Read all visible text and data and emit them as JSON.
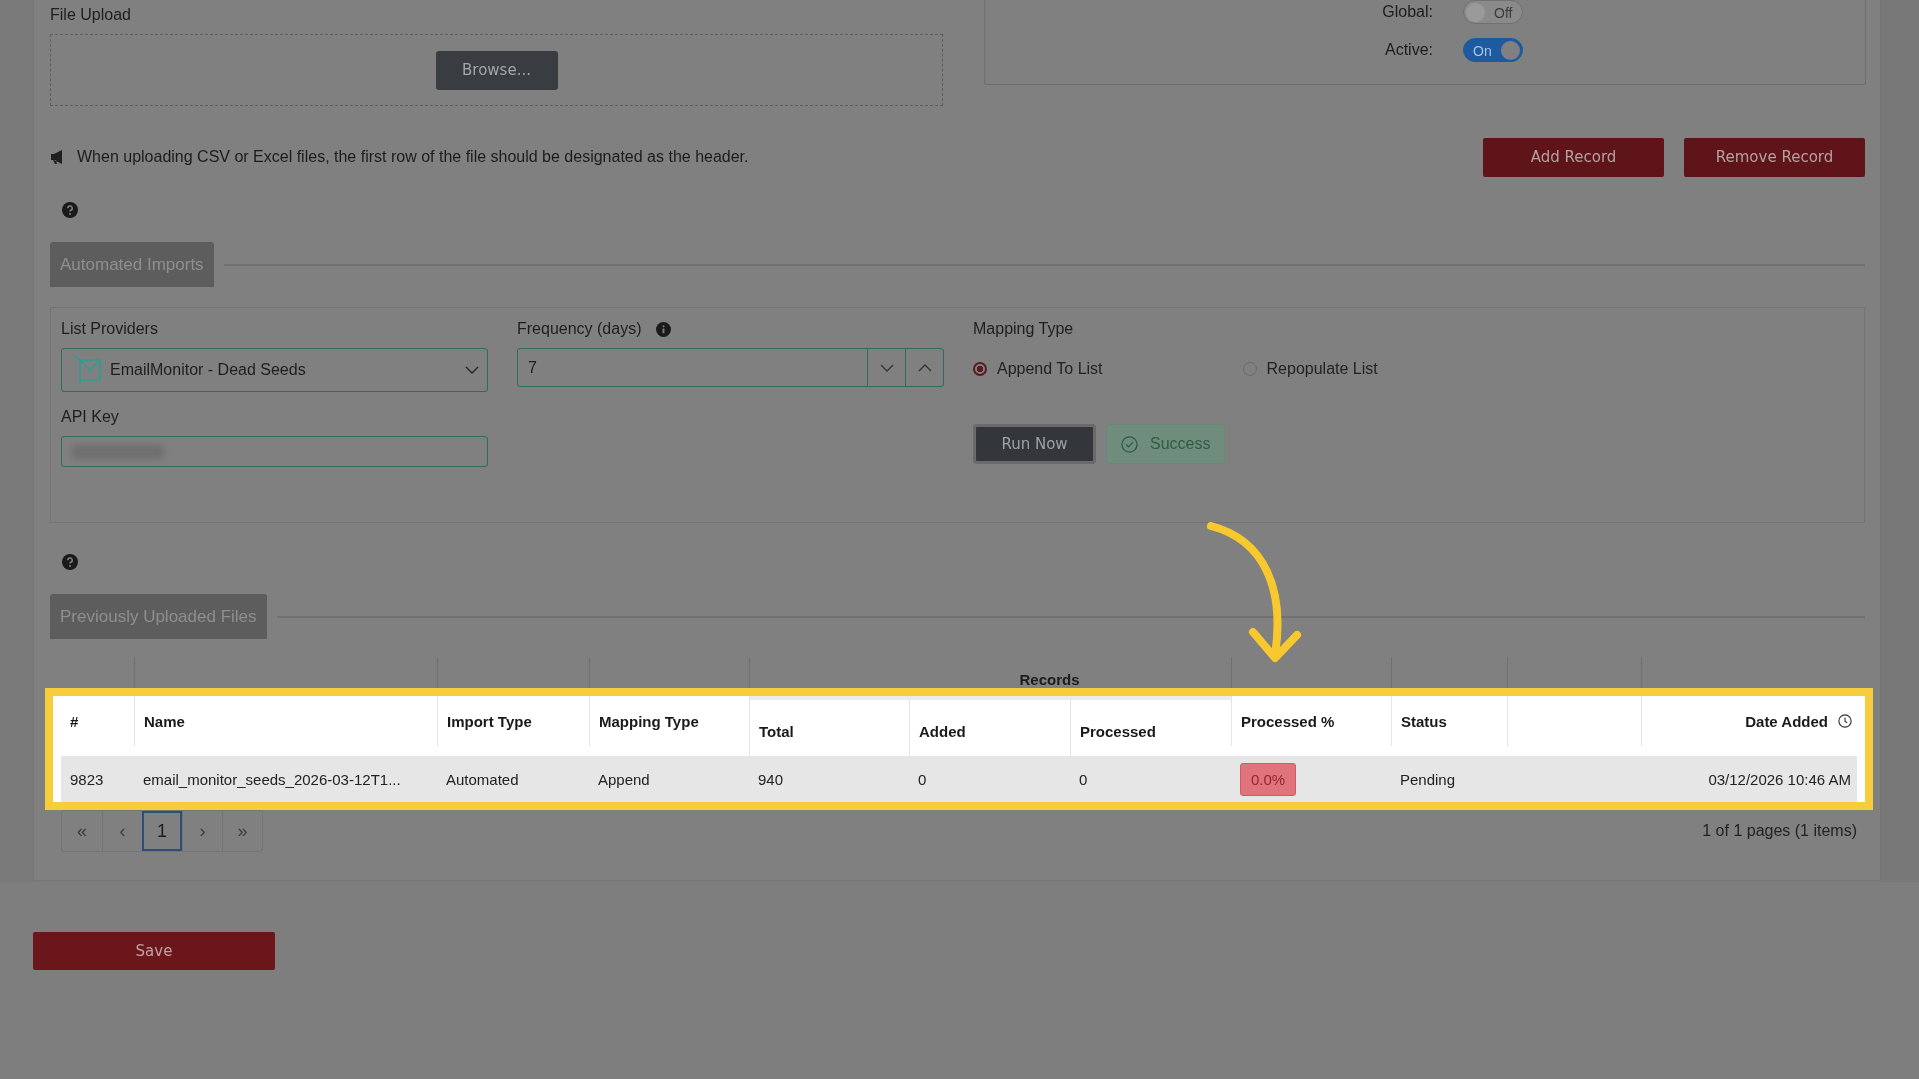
{
  "file_upload": {
    "label": "File Upload",
    "browse_button": "Browse...",
    "note": "When uploading CSV or Excel files, the first row of the file should be designated as the header."
  },
  "settings": {
    "toggles": [
      {
        "label": "Global:",
        "text": "Off",
        "on": false
      },
      {
        "label": "Active:",
        "text": "On",
        "on": true
      }
    ]
  },
  "record_buttons": [
    "Add Record",
    "Remove Record"
  ],
  "automated_imports": {
    "title": "Automated Imports",
    "list_providers": {
      "label": "List Providers",
      "value": "EmailMonitor - Dead Seeds"
    },
    "frequency": {
      "label": "Frequency (days)",
      "value": "7"
    },
    "api_key": {
      "label": "API Key"
    },
    "mapping_type": {
      "label": "Mapping Type",
      "options": [
        {
          "label": "Append To List",
          "selected": true
        },
        {
          "label": "Repopulate List",
          "selected": false
        }
      ]
    },
    "run_button": "Run Now",
    "result_badge": "Success"
  },
  "uploaded_files": {
    "title": "Previously Uploaded Files",
    "group_header": "Records",
    "columns": [
      {
        "label": "#",
        "kind": "plain"
      },
      {
        "label": "Name",
        "kind": "plain"
      },
      {
        "label": "Import Type",
        "kind": "plain"
      },
      {
        "label": "Mapping Type",
        "kind": "plain"
      },
      {
        "label": "Total",
        "kind": "grouped"
      },
      {
        "label": "Added",
        "kind": "grouped"
      },
      {
        "label": "Processed",
        "kind": "grouped"
      },
      {
        "label": "Processed %",
        "kind": "plain"
      },
      {
        "label": "Status",
        "kind": "plain"
      },
      {
        "kind": "blank"
      },
      {
        "label": "Date Added",
        "kind": "date"
      }
    ],
    "rows": [
      {
        "cells": [
          {
            "text": "9823",
            "kind": "text"
          },
          {
            "text": "email_monitor_seeds_2026-03-12T1...",
            "kind": "text"
          },
          {
            "text": "Automated",
            "kind": "text"
          },
          {
            "text": "Append",
            "kind": "text"
          },
          {
            "text": "940",
            "kind": "text"
          },
          {
            "text": "0",
            "kind": "text"
          },
          {
            "text": "0",
            "kind": "text"
          },
          {
            "text": "0.0%",
            "kind": "badge"
          },
          {
            "text": "Pending",
            "kind": "text"
          },
          {
            "kind": "blank"
          },
          {
            "text": "03/12/2026 10:46 AM",
            "kind": "date"
          }
        ]
      }
    ],
    "pagination": {
      "pages": [
        {
          "label": "«",
          "selected": false
        },
        {
          "label": "‹",
          "selected": false
        },
        {
          "label": "1",
          "selected": true
        },
        {
          "label": "›",
          "selected": false
        },
        {
          "label": "»",
          "selected": false
        }
      ],
      "summary": "1 of 1 pages (1 items)"
    }
  },
  "save_button": "Save"
}
